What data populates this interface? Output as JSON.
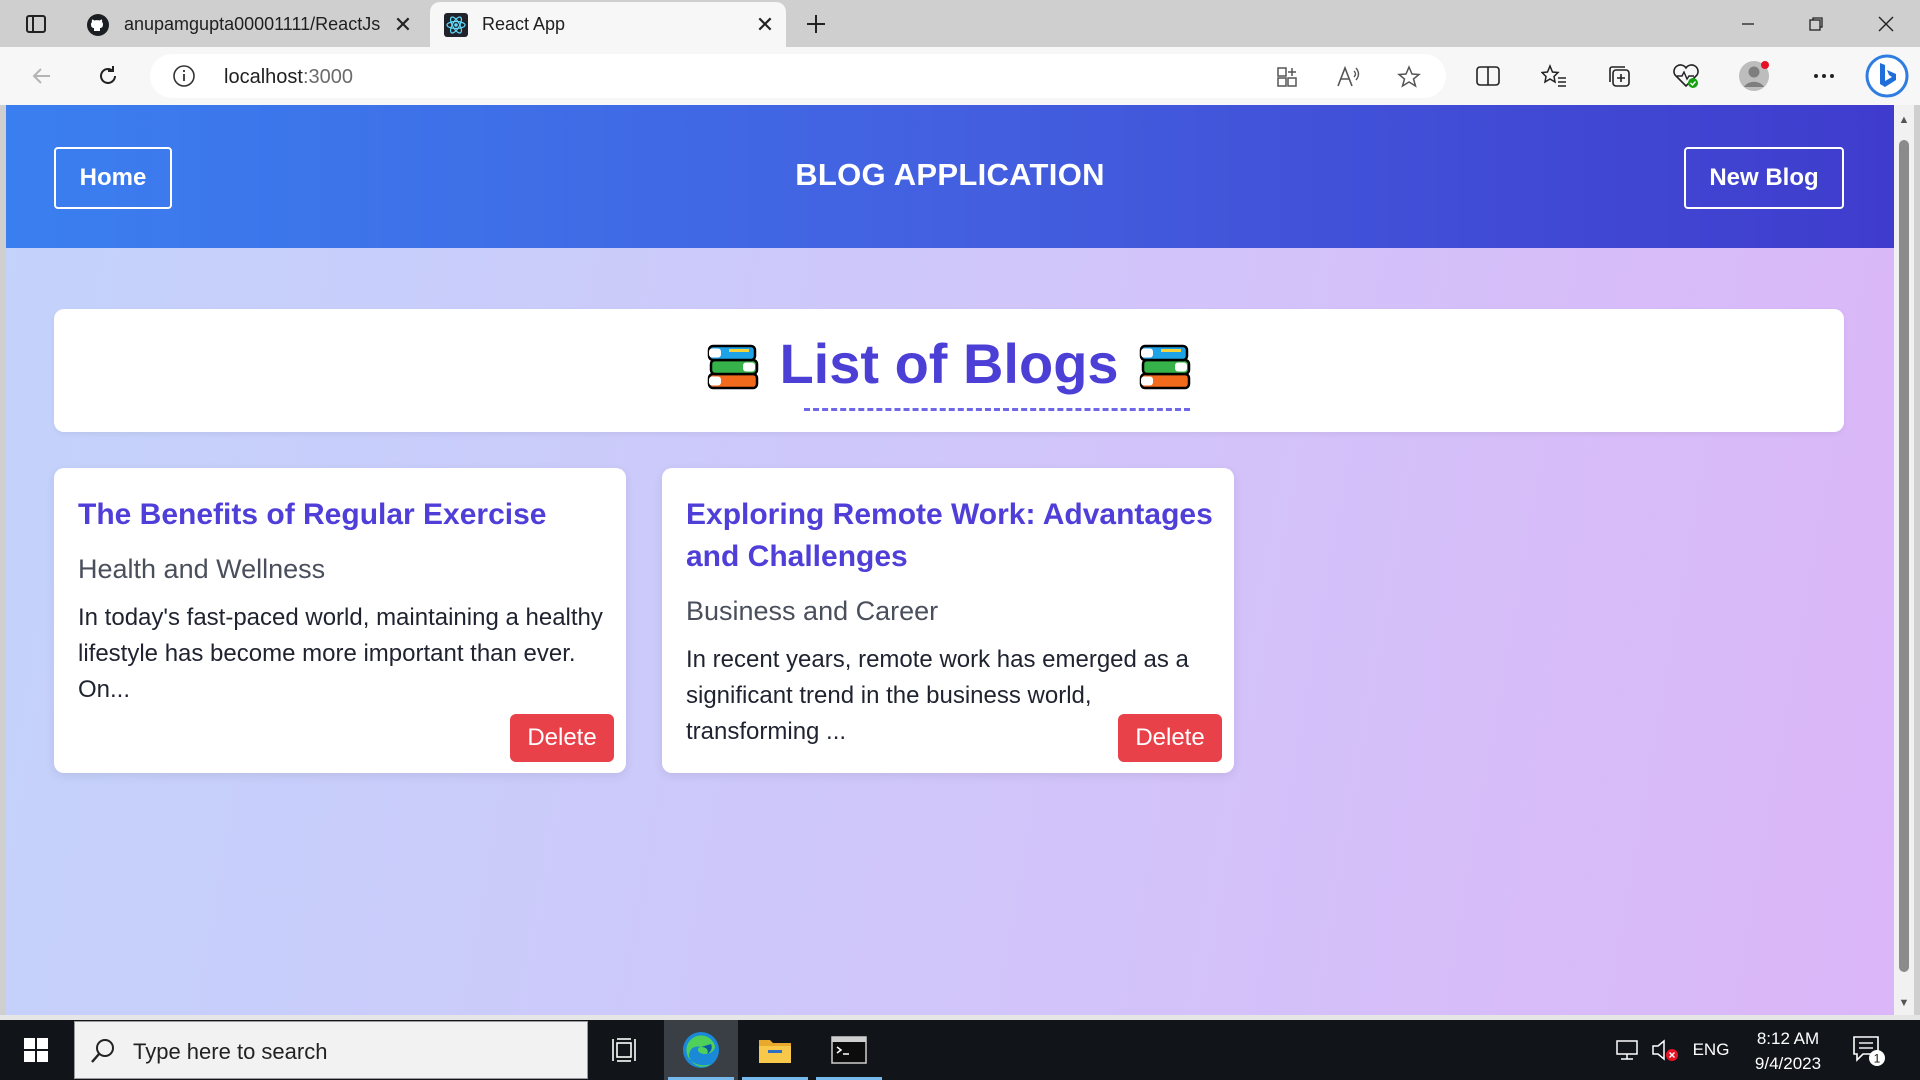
{
  "browser": {
    "tabs": [
      {
        "title": "anupamgupta00001111/ReactJs",
        "icon": "github-icon",
        "active": false
      },
      {
        "title": "React App",
        "icon": "react-icon",
        "active": true
      }
    ],
    "address": {
      "host": "localhost",
      "port": ":3000"
    }
  },
  "app": {
    "nav": {
      "home_label": "Home",
      "title": "BLOG APPLICATION",
      "new_label": "New Blog"
    },
    "list_title": "List of Blogs",
    "blogs": [
      {
        "title": "The Benefits of Regular Exercise",
        "category": "Health and Wellness",
        "excerpt": "In today's fast-paced world, maintaining a healthy lifestyle has become more important than ever. On...",
        "delete_label": "Delete"
      },
      {
        "title": "Exploring Remote Work: Advantages and Challenges",
        "category": "Business and Career",
        "excerpt": "In recent years, remote work has emerged as a significant trend in the business world, transforming ...",
        "delete_label": "Delete"
      }
    ],
    "colors": {
      "accent": "#4c3fd6",
      "delete": "#e8414a",
      "nav_start": "#3a7ff0",
      "nav_end": "#3f3ccd"
    }
  },
  "taskbar": {
    "search_placeholder": "Type here to search",
    "language": "ENG",
    "time": "8:12 AM",
    "date": "9/4/2023",
    "notification_count": "1"
  }
}
